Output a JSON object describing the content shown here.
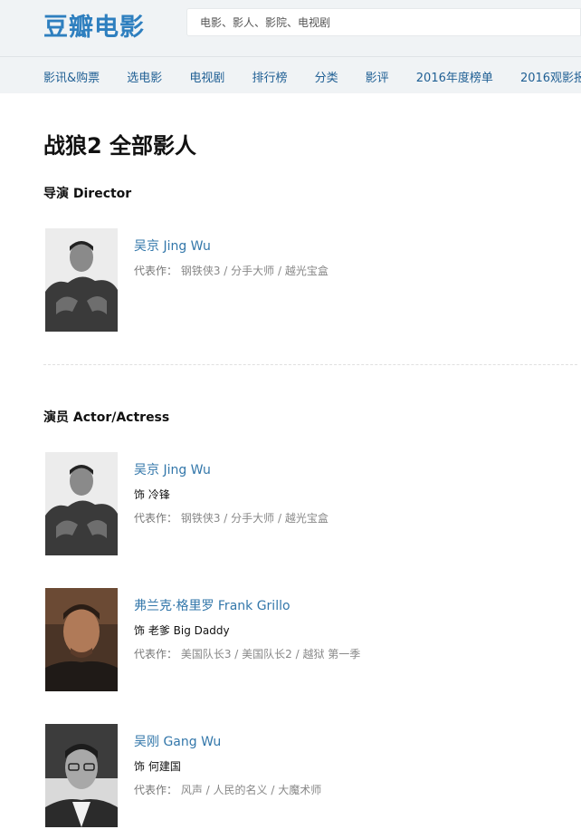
{
  "header": {
    "logo": "豆瓣电影",
    "search_placeholder": "电影、影人、影院、电视剧",
    "nav": [
      "影讯&购票",
      "选电影",
      "电视剧",
      "排行榜",
      "分类",
      "影评",
      "2016年度榜单",
      "2016观影报告"
    ]
  },
  "page_title": "战狼2 全部影人",
  "sections": [
    {
      "title": "导演 Director",
      "people": [
        {
          "name": "吴京 Jing Wu",
          "role": "",
          "works_label": "代表作：",
          "works": "钢铁侠3 / 分手大师 / 越光宝盒"
        }
      ]
    },
    {
      "title": "演员 Actor/Actress",
      "people": [
        {
          "name": "吴京 Jing Wu",
          "role": "饰 冷锋",
          "works_label": "代表作：",
          "works": "钢铁侠3 / 分手大师 / 越光宝盒"
        },
        {
          "name": "弗兰克·格里罗 Frank Grillo",
          "role": "饰 老爹 Big Daddy",
          "works_label": "代表作：",
          "works": "美国队长3 / 美国队长2 / 越狱 第一季"
        },
        {
          "name": "吴刚 Gang Wu",
          "role": "饰 何建国",
          "works_label": "代表作：",
          "works": "风声 / 人民的名义 / 大魔术师"
        }
      ]
    }
  ]
}
